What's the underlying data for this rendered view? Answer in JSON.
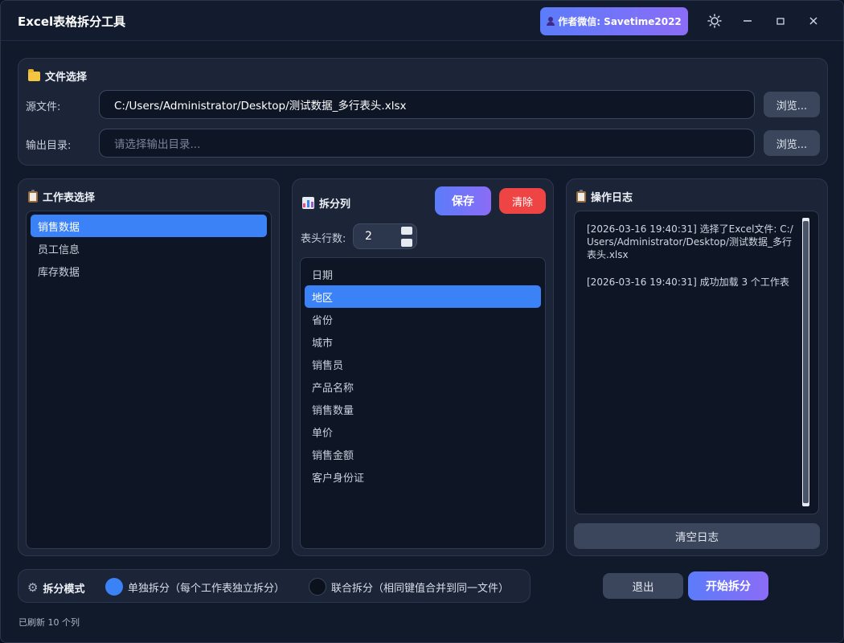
{
  "app": {
    "title": "Excel表格拆分工具",
    "author_label": "作者微信: Savetime2022",
    "theme_icon": "sun-icon",
    "minimize_icon": "minimize-icon",
    "maximize_icon": "maximize-icon",
    "close_icon": "close-icon"
  },
  "file_section": {
    "title": "文件选择",
    "source_label": "源文件:",
    "source_value": "C:/Users/Administrator/Desktop/测试数据_多行表头.xlsx",
    "output_label": "输出目录:",
    "output_placeholder": "请选择输出目录...",
    "browse_label": "浏览..."
  },
  "sheet_section": {
    "title": "工作表选择",
    "items": [
      "销售数据",
      "员工信息",
      "库存数据"
    ],
    "selected_index": 0
  },
  "split_section": {
    "title": "拆分列",
    "save_label": "保存",
    "clear_label": "清除",
    "header_rows_label": "表头行数:",
    "header_rows_value": "2",
    "columns": [
      "日期",
      "地区",
      "省份",
      "城市",
      "销售员",
      "产品名称",
      "销售数量",
      "单价",
      "销售金额",
      "客户身份证"
    ],
    "selected_index": 1
  },
  "log_section": {
    "title": "操作日志",
    "lines": [
      "[2026-03-16 19:40:31] 选择了Excel文件: C:/Users/Administrator/Desktop/测试数据_多行表头.xlsx",
      "[2026-03-16 19:40:31] 成功加载 3 个工作表"
    ],
    "clear_label": "清空日志"
  },
  "mode_section": {
    "title": "拆分模式",
    "options": [
      "单独拆分（每个工作表独立拆分）",
      "联合拆分（相同键值合并到同一文件）"
    ],
    "selected_index": 0
  },
  "actions": {
    "exit_label": "退出",
    "start_label": "开始拆分"
  },
  "status": "已刷新 10 个列",
  "colors": {
    "accent": "#3b82f6",
    "gradient_start": "#5b7cfa",
    "gradient_end": "#8b6cf6",
    "danger": "#ef4444",
    "background": "#111a2b"
  }
}
